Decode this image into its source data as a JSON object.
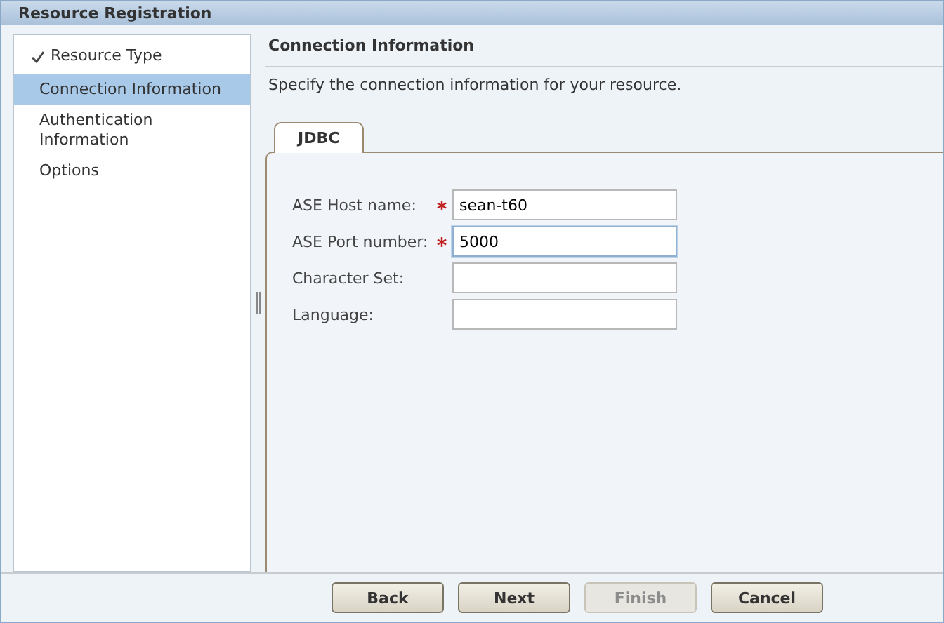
{
  "window": {
    "title": "Resource Registration"
  },
  "steps": [
    {
      "label": "Resource Type",
      "completed": true,
      "selected": false
    },
    {
      "label": "Connection Information",
      "completed": false,
      "selected": true
    },
    {
      "label": "Authentication Information",
      "completed": false,
      "selected": false
    },
    {
      "label": "Options",
      "completed": false,
      "selected": false
    }
  ],
  "header": {
    "title": "Connection Information",
    "description": "Specify the connection information for your resource."
  },
  "tabs": [
    {
      "label": "JDBC",
      "selected": true
    }
  ],
  "fields": [
    {
      "label": "ASE Host name:",
      "required": true,
      "value": "sean-t60",
      "focused": false
    },
    {
      "label": "ASE Port number:",
      "required": true,
      "value": "5000",
      "focused": true
    },
    {
      "label": "Character Set:",
      "required": false,
      "focused": false
    },
    {
      "label": "Language:",
      "required": false,
      "focused": false
    }
  ],
  "buttons": [
    {
      "label": "Back",
      "disabled": false
    },
    {
      "label": "Next",
      "disabled": false
    },
    {
      "label": "Finish",
      "disabled": true
    },
    {
      "label": "Cancel",
      "disabled": false
    }
  ]
}
